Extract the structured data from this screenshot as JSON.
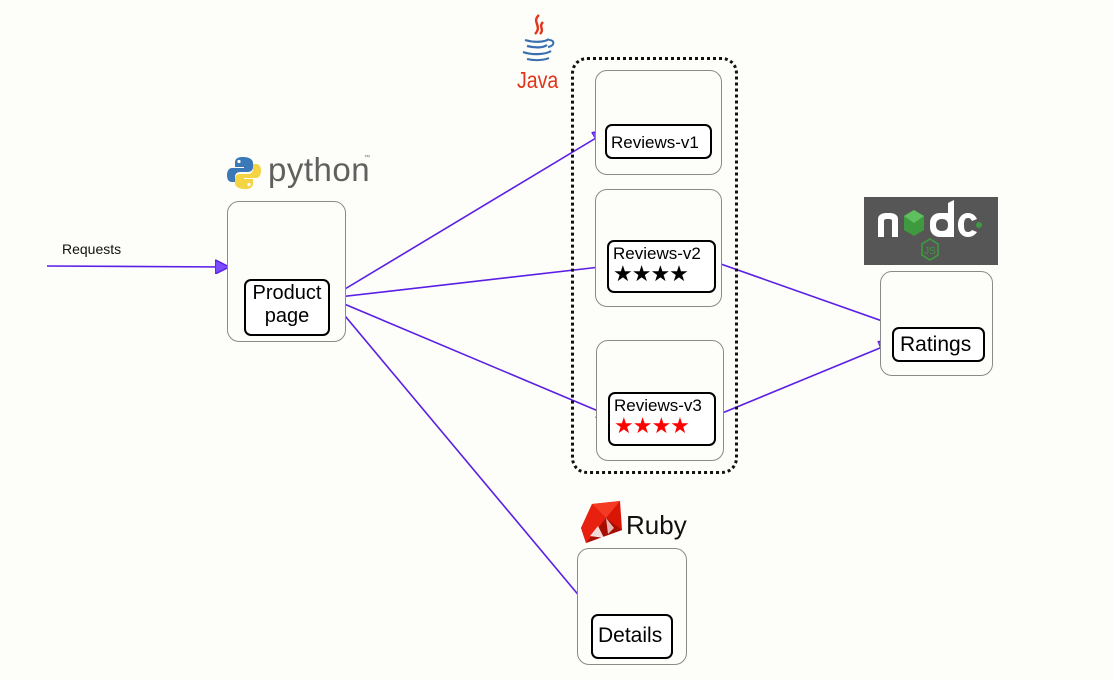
{
  "diagram": {
    "requests_label": "Requests",
    "arrow_color": "#5a1ee6",
    "services": {
      "productpage": {
        "label_line1": "Product",
        "label_line2": "page",
        "tech": "python",
        "tech_mark": "™"
      },
      "reviews_v1": {
        "label": "Reviews-v1",
        "tech": "Java"
      },
      "reviews_v2": {
        "label": "Reviews-v2",
        "stars": "★★★★",
        "star_color": "#000000"
      },
      "reviews_v3": {
        "label": "Reviews-v3",
        "stars": "★★★★",
        "star_color": "#ff0000"
      },
      "ratings": {
        "label": "Ratings",
        "tech": "node",
        "tech_sub": "JS"
      },
      "details": {
        "label": "Details",
        "tech": "Ruby"
      }
    },
    "edges": [
      {
        "from": "requests",
        "to": "productpage"
      },
      {
        "from": "productpage",
        "to": "reviews_v1"
      },
      {
        "from": "productpage",
        "to": "reviews_v2"
      },
      {
        "from": "productpage",
        "to": "reviews_v3"
      },
      {
        "from": "productpage",
        "to": "details"
      },
      {
        "from": "reviews_v2",
        "to": "ratings"
      },
      {
        "from": "reviews_v3",
        "to": "ratings"
      }
    ]
  }
}
